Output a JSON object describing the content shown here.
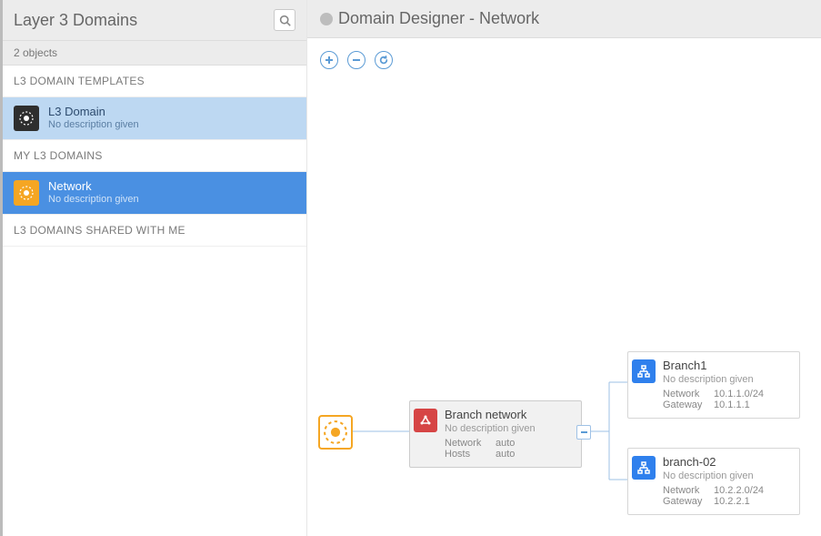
{
  "sidebar": {
    "title": "Layer 3 Domains",
    "object_count_label": "2 objects",
    "sections": [
      {
        "header": "L3 DOMAIN TEMPLATES"
      },
      {
        "header": "MY L3 DOMAINS"
      },
      {
        "header": "L3 DOMAINS SHARED WITH ME"
      }
    ],
    "templates": [
      {
        "name": "L3 Domain",
        "desc": "No description given"
      }
    ],
    "domains": [
      {
        "name": "Network",
        "desc": "No description given"
      }
    ]
  },
  "main": {
    "title": "Domain Designer - Network"
  },
  "diagram": {
    "branch_network": {
      "title": "Branch network",
      "desc": "No description given",
      "network_label": "Network",
      "network_value": "auto",
      "hosts_label": "Hosts",
      "hosts_value": "auto"
    },
    "subnets": [
      {
        "title": "Branch1",
        "desc": "No description given",
        "network_label": "Network",
        "network_value": "10.1.1.0/24",
        "gateway_label": "Gateway",
        "gateway_value": "10.1.1.1"
      },
      {
        "title": "branch-02",
        "desc": "No description given",
        "network_label": "Network",
        "network_value": "10.2.2.0/24",
        "gateway_label": "Gateway",
        "gateway_value": "10.2.2.1"
      }
    ]
  },
  "icons": {
    "search": "search-icon",
    "add": "plus-icon",
    "remove": "minus-icon",
    "reload": "reload-icon"
  }
}
